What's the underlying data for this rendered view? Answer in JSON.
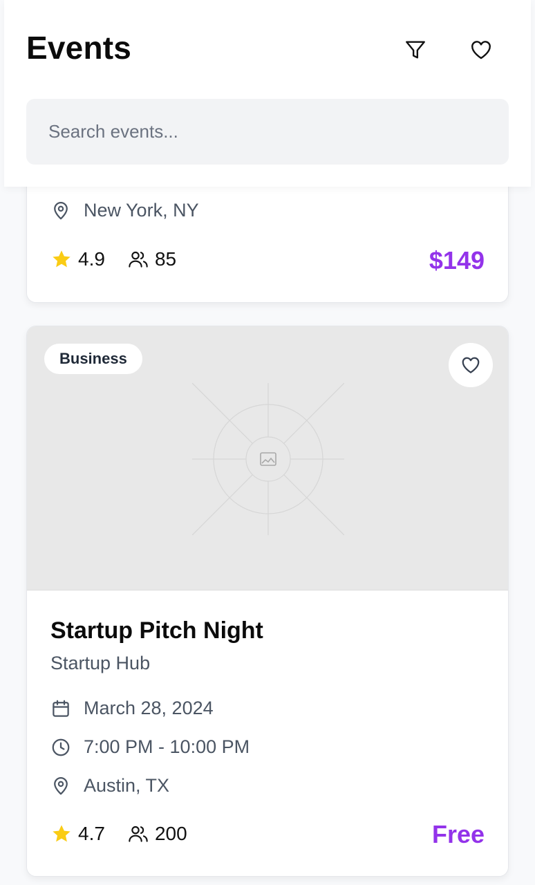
{
  "header": {
    "title": "Events",
    "filter_icon": "filter-icon",
    "favorites_icon": "heart-icon",
    "search_placeholder": "Search events..."
  },
  "events": [
    {
      "location": "New York, NY",
      "rating": "4.9",
      "attendees": "85",
      "price": "$149"
    },
    {
      "category": "Business",
      "title": "Startup Pitch Night",
      "organizer": "Startup Hub",
      "date": "March 28, 2024",
      "time": "7:00 PM - 10:00 PM",
      "location": "Austin, TX",
      "rating": "4.7",
      "attendees": "200",
      "price": "Free"
    }
  ],
  "colors": {
    "accent": "#9333ea",
    "star": "#facc15",
    "muted_text": "#4b5563",
    "image_placeholder": "#e8e8e8"
  }
}
